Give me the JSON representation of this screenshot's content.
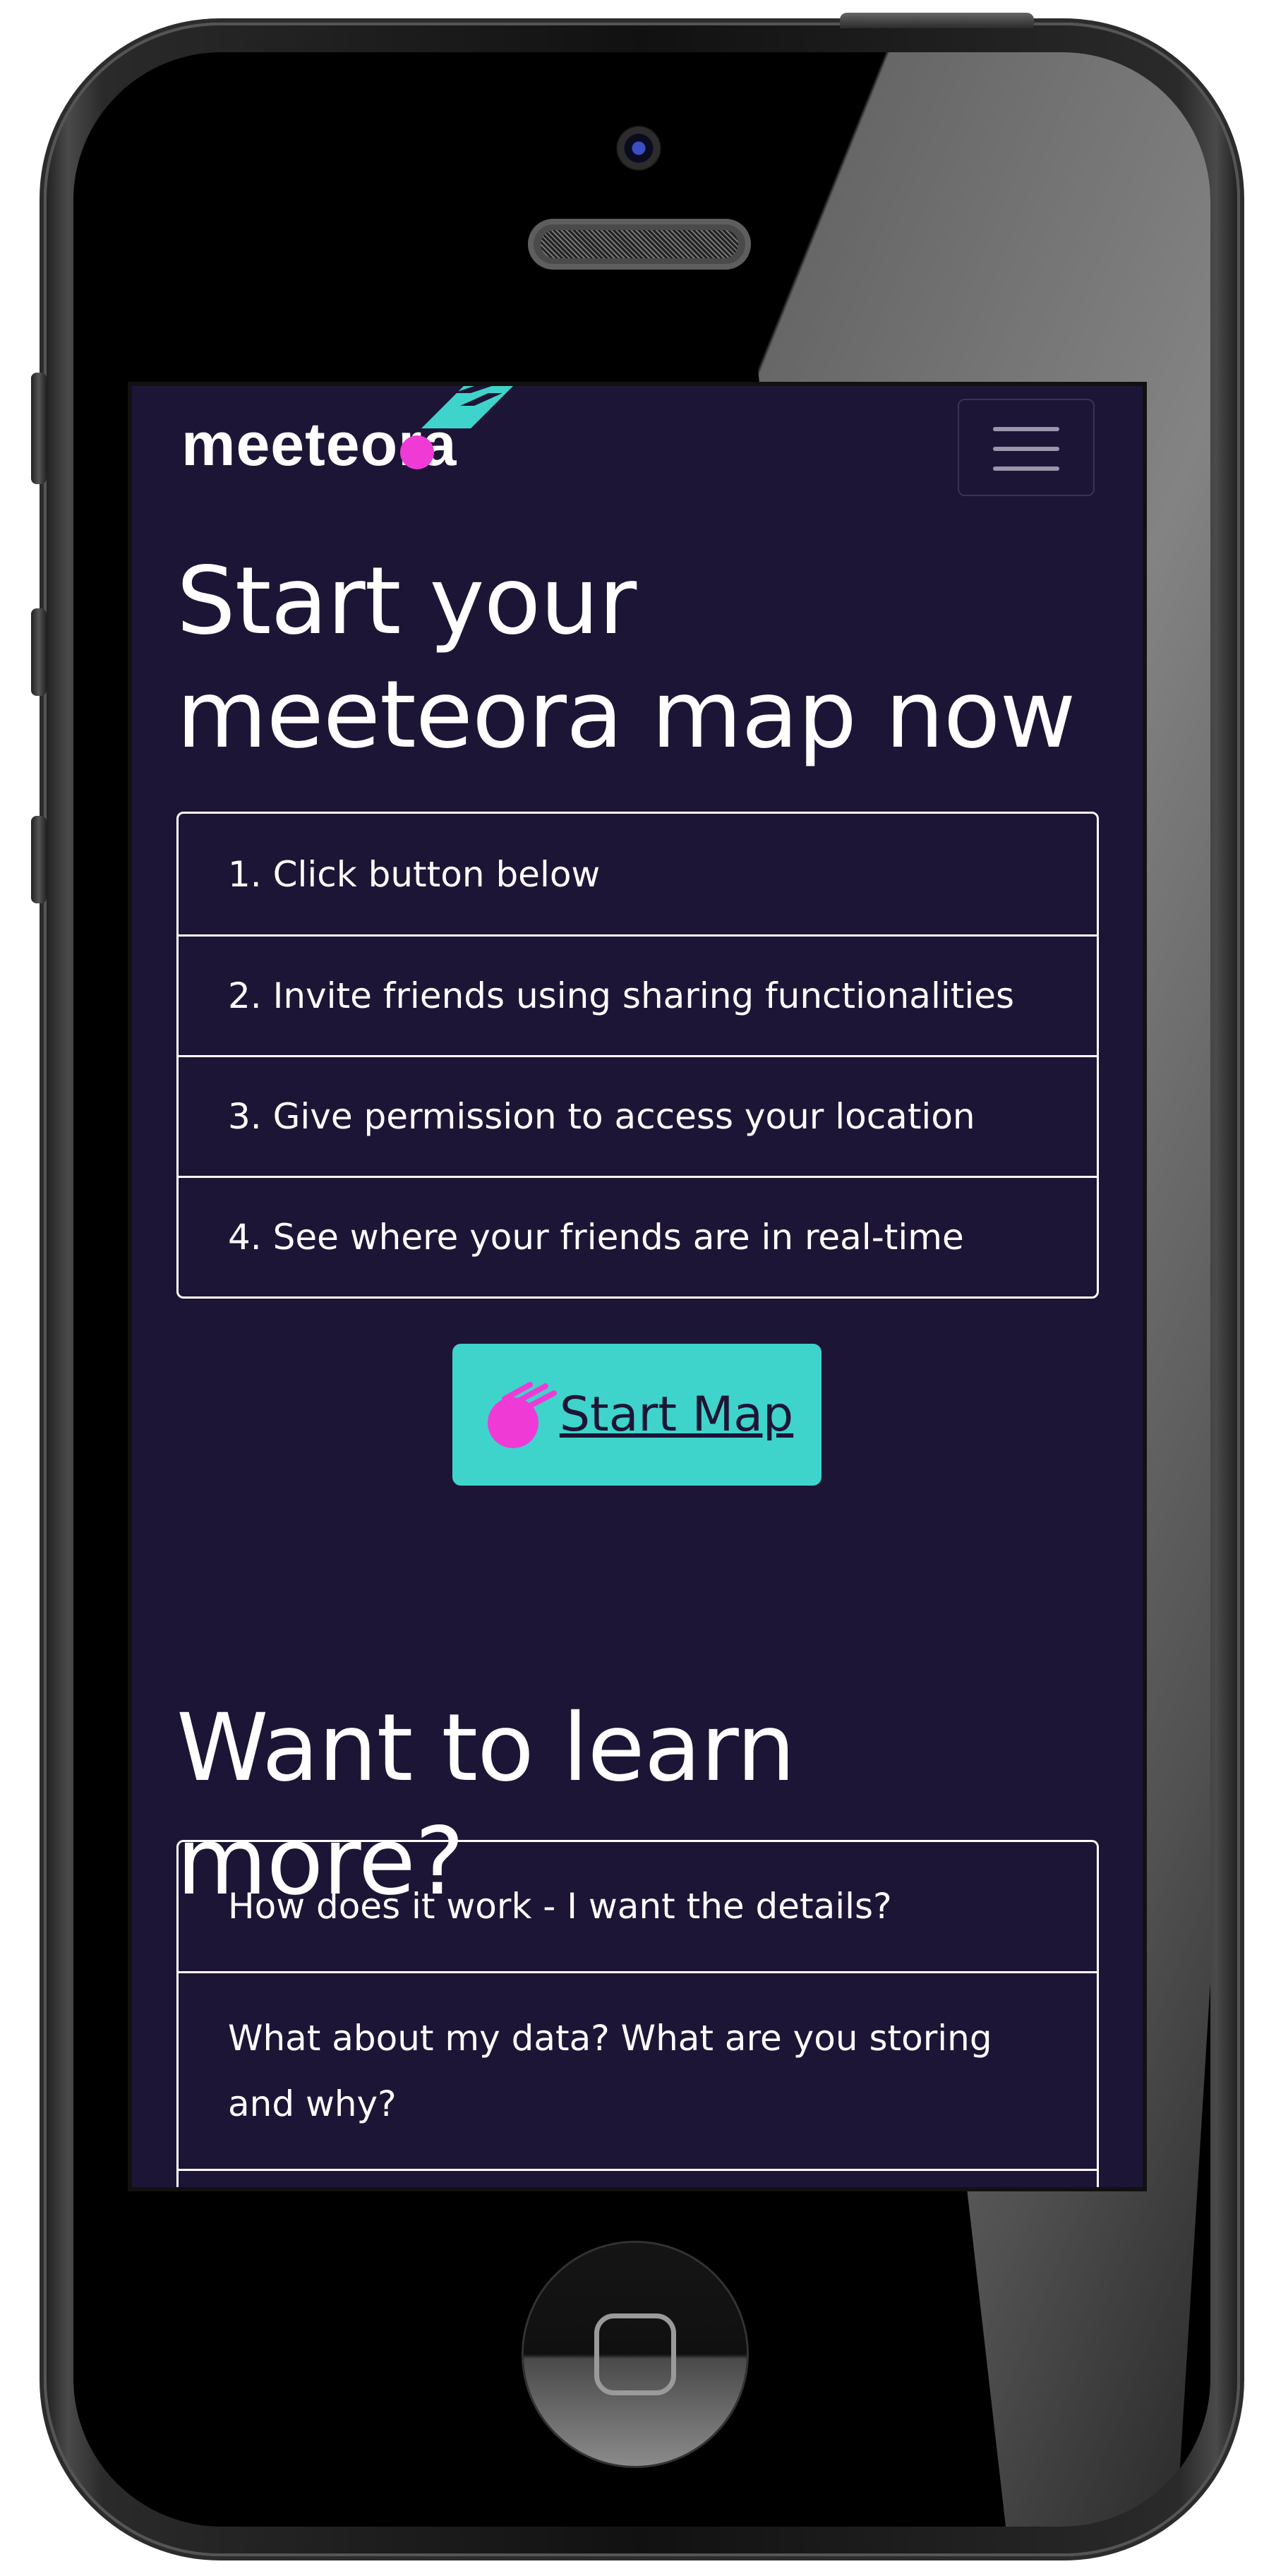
{
  "logo": {
    "text": "meeteora"
  },
  "navbar": {
    "menu_icon": "hamburger-icon"
  },
  "hero": {
    "title": "Start your meeteora map now",
    "steps": [
      "1. Click button below",
      "2. Invite friends using sharing functionalities",
      "3. Give permission to access your location",
      "4. See where your friends are in real-time"
    ],
    "start_button": {
      "label": "Start Map",
      "icon": "meteor-icon"
    }
  },
  "learn": {
    "title": "Want to learn more?",
    "faq": [
      "How does it work - I want the details?",
      "What about my data? What are you storing and why?"
    ]
  },
  "colors": {
    "background": "#1d1536",
    "accent": "#3ed4cc",
    "brand_pink": "#f03ad6",
    "text": "#ffffff"
  }
}
